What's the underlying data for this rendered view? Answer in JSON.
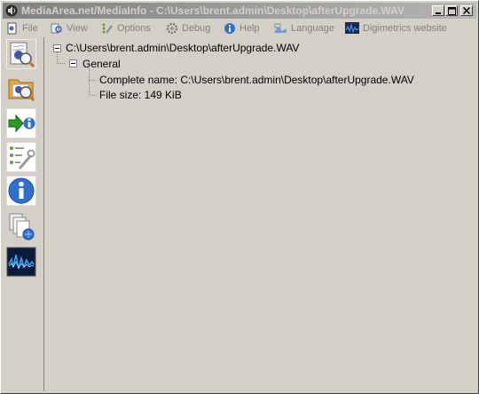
{
  "window": {
    "title": "MediaArea.net/MediaInfo - C:\\Users\\brent.admin\\Desktop\\afterUpgrade.WAV"
  },
  "menu": {
    "items": [
      {
        "label": "File",
        "icon": "file-icon"
      },
      {
        "label": "View",
        "icon": "view-icon"
      },
      {
        "label": "Options",
        "icon": "options-icon"
      },
      {
        "label": "Debug",
        "icon": "debug-icon"
      },
      {
        "label": "Help",
        "icon": "help-icon"
      },
      {
        "label": "Language",
        "icon": "language-icon"
      },
      {
        "label": "Digimetrics website",
        "icon": "digimetrics-icon"
      }
    ]
  },
  "toolbar": {
    "buttons": [
      "open-file-icon",
      "open-folder-icon",
      "export-icon",
      "preferences-icon",
      "about-icon",
      "check-updates-icon",
      "digimetrics-logo-icon"
    ]
  },
  "tree": {
    "root": "C:\\Users\\brent.admin\\Desktop\\afterUpgrade.WAV",
    "section": "General",
    "complete_name": "Complete name: C:\\Users\\brent.admin\\Desktop\\afterUpgrade.WAV",
    "file_size": "File size: 149 KiB"
  }
}
